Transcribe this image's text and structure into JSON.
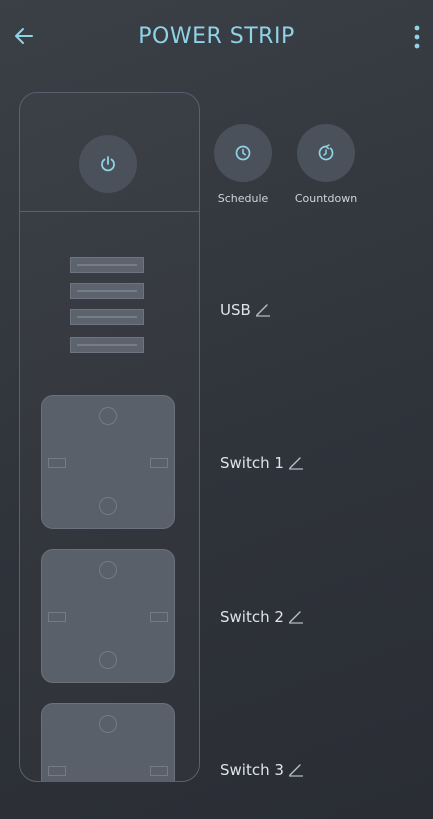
{
  "header": {
    "title": "POWER STRIP"
  },
  "controls": {
    "schedule_label": "Schedule",
    "countdown_label": "Countdown"
  },
  "outlets": [
    {
      "label": "USB"
    },
    {
      "label": "Switch 1"
    },
    {
      "label": "Switch 2"
    },
    {
      "label": "Switch 3"
    }
  ],
  "colors": {
    "accent": "#8fd3e6",
    "background": "#33373e",
    "button": "#4b515a"
  },
  "icons": {
    "back": "arrow-left-icon",
    "menu": "more-vertical-icon",
    "power": "power-icon",
    "schedule": "clock-icon",
    "countdown": "timer-icon",
    "edit": "pencil-icon"
  }
}
